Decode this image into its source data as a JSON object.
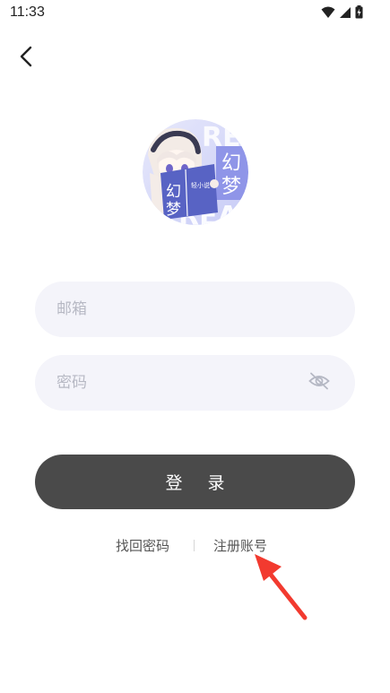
{
  "status_bar": {
    "time": "11:33"
  },
  "avatar": {
    "book_text_1": "幻",
    "book_text_2": "梦",
    "book_subtext": "轻小说",
    "side_text_1": "幻",
    "side_text_2": "梦",
    "bg_letters": "READ"
  },
  "form": {
    "email_placeholder": "邮箱",
    "password_placeholder": "密码",
    "login_label": "登录"
  },
  "links": {
    "forgot_password": "找回密码",
    "register": "注册账号"
  },
  "colors": {
    "button_bg": "#4a4a4a",
    "field_bg": "#f4f4fa",
    "annotation_arrow": "#f23a2f"
  },
  "icons": [
    "back-arrow-icon",
    "wifi-icon",
    "signal-icon",
    "battery-icon",
    "eye-off-icon"
  ]
}
